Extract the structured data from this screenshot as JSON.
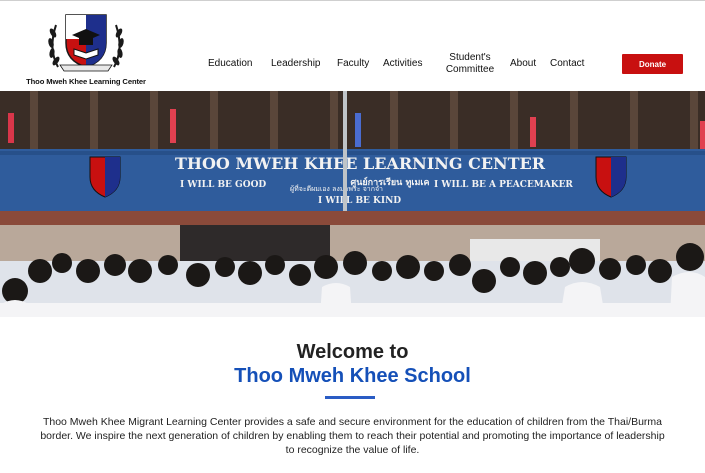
{
  "brand": {
    "name": "Thoo Mweh Khee Learning Center",
    "colors": {
      "red": "#c81010",
      "blue": "#1550b8",
      "navy": "#1e2f8c"
    }
  },
  "nav": {
    "items": [
      {
        "id": "education",
        "label": "Education"
      },
      {
        "id": "leadership",
        "label": "Leadership"
      },
      {
        "id": "faculty",
        "label": "Faculty"
      },
      {
        "id": "activities",
        "label": "Activities"
      },
      {
        "id": "students-committee",
        "label": "Student's Committee"
      },
      {
        "id": "about",
        "label": "About"
      },
      {
        "id": "contact",
        "label": "Contact"
      }
    ],
    "donate_label": "Donate"
  },
  "hero": {
    "banner_title": "THOO MWEH KHEE LEARNING CENTER",
    "banner_thai": "ศูนย์การเรียน ทูเมเค",
    "banner_left": "I WILL BE GOOD",
    "banner_center_1": "ผู้ที่จะดีผมเอง     ลงมาพระ จากจำ",
    "banner_center_2": "I WILL BE KIND",
    "banner_right": "I WILL BE A PEACEMAKER"
  },
  "welcome": {
    "line1": "Welcome to",
    "line2": "Thoo Mweh Khee School",
    "description": "Thoo Mweh Khee Migrant Learning Center provides a safe and secure environment for the education of children from the Thai/Burma border. We inspire the next generation of children by enabling them to reach their potential and promoting the importance of leadership to recognize the value of life."
  }
}
